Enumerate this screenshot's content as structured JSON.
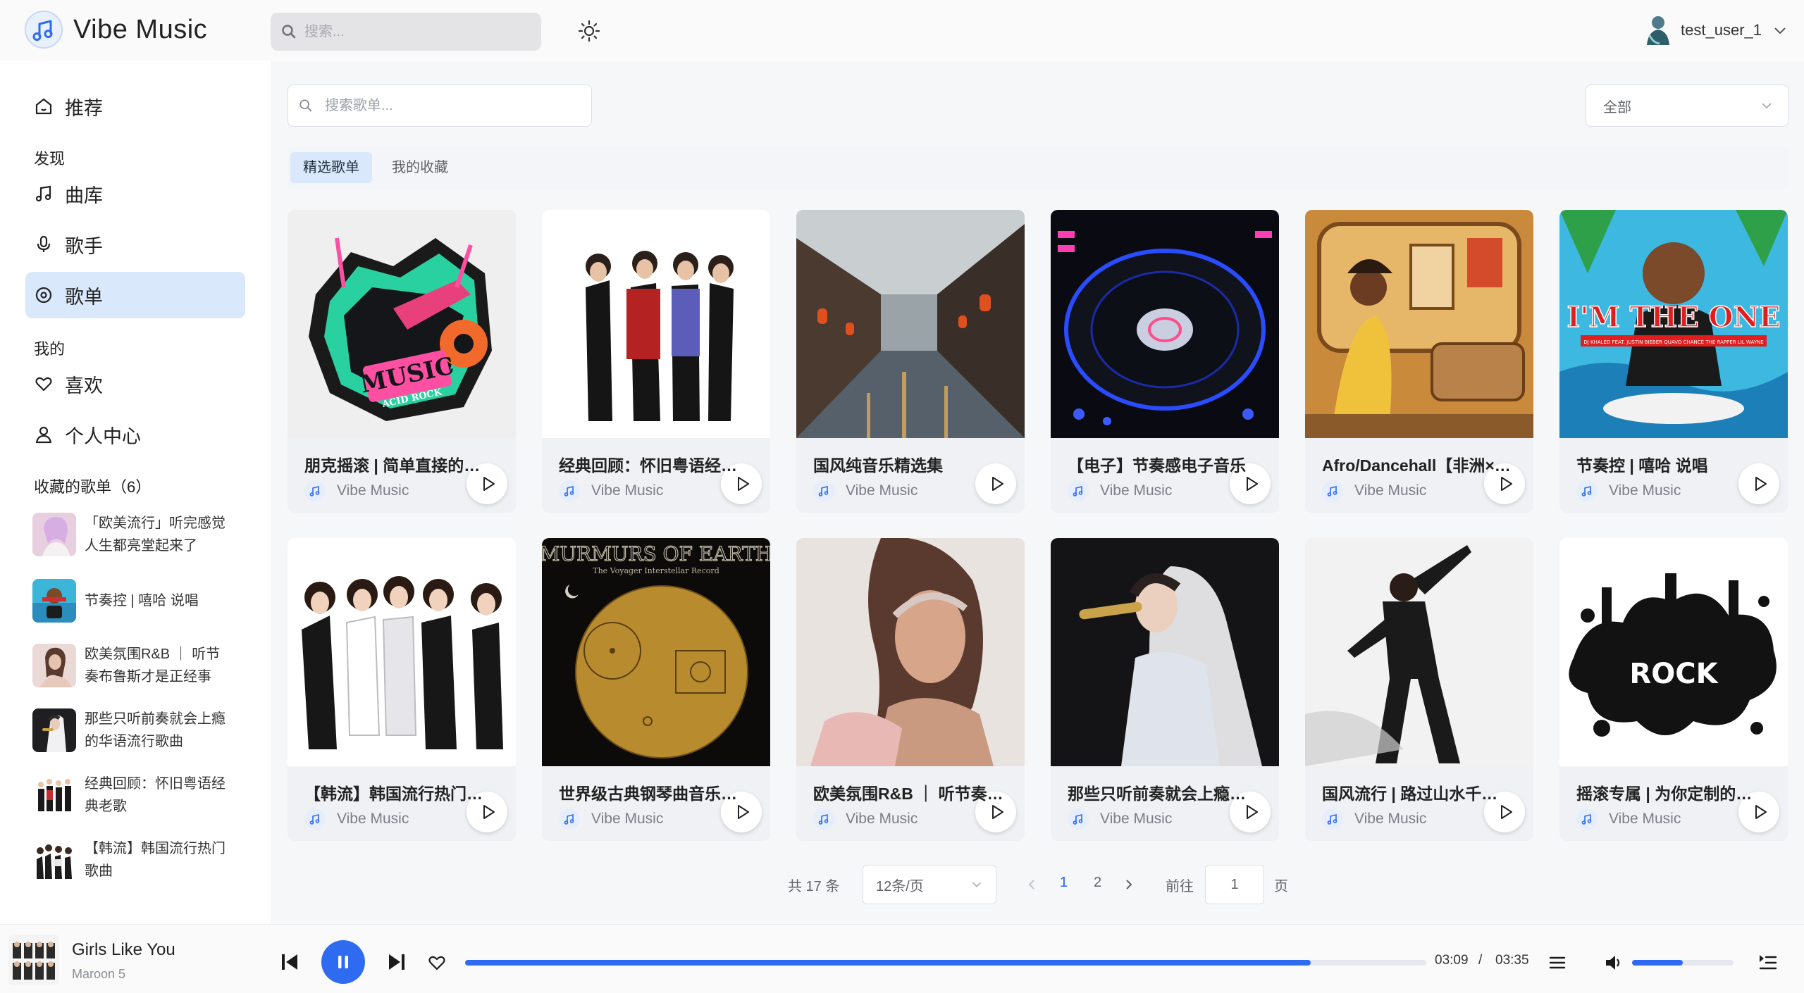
{
  "header": {
    "app_name": "Vibe Music",
    "search_placeholder": "搜索...",
    "username": "test_user_1"
  },
  "sidebar": {
    "nav_recommend": "推荐",
    "section_discover": "发现",
    "nav_library": "曲库",
    "nav_artists": "歌手",
    "nav_playlists": "歌单",
    "section_mine": "我的",
    "nav_likes": "喜欢",
    "nav_profile": "个人中心",
    "collections_title": "收藏的歌单（6）",
    "collections": [
      {
        "line1": "「欧美流行」听完感觉",
        "line2": "人生都亮堂起来了"
      },
      {
        "line1": "节奏控 | 嘻哈 说唱",
        "line2": ""
      },
      {
        "line1": "欧美氛围R&B ｜ 听节",
        "line2": "奏布鲁斯才是正经事"
      },
      {
        "line1": "那些只听前奏就会上瘾",
        "line2": "的华语流行歌曲"
      },
      {
        "line1": "经典回顾：怀旧粤语经",
        "line2": "典老歌"
      },
      {
        "line1": "【韩流】韩国流行热门",
        "line2": "歌曲"
      }
    ]
  },
  "main": {
    "search_placeholder": "搜索歌单...",
    "category_value": "全部",
    "tabs": [
      "精选歌单",
      "我的收藏"
    ],
    "playlists": [
      {
        "title": "朋克摇滚 | 简单直接的…",
        "author": "Vibe Music"
      },
      {
        "title": "经典回顾：怀旧粤语经…",
        "author": "Vibe Music"
      },
      {
        "title": "国风纯音乐精选集",
        "author": "Vibe Music"
      },
      {
        "title": "【电子】节奏感电子音乐",
        "author": "Vibe Music"
      },
      {
        "title": "Afro/Dancehall【非洲×…",
        "author": "Vibe Music"
      },
      {
        "title": "节奏控 | 嘻哈 说唱",
        "author": "Vibe Music"
      },
      {
        "title": "【韩流】韩国流行热门…",
        "author": "Vibe Music"
      },
      {
        "title": "世界级古典钢琴曲音乐…",
        "author": "Vibe Music"
      },
      {
        "title": "欧美氛围R&B ｜ 听节奏…",
        "author": "Vibe Music"
      },
      {
        "title": "那些只听前奏就会上瘾…",
        "author": "Vibe Music"
      },
      {
        "title": "国风流行 | 路过山水千…",
        "author": "Vibe Music"
      },
      {
        "title": "摇滚专属 | 为你定制的…",
        "author": "Vibe Music"
      }
    ],
    "cover_text": {
      "punk_main": "MUSIC",
      "punk_sub": "ACID ROCK",
      "hiphop_main": "I'M THE ONE",
      "hiphop_sub": "DJ KHALED FEAT. JUSTIN BIEBER QUAVO CHANCE THE RAPPER LIL WAYNE",
      "classical_main": "MURMURS OF EARTH",
      "classical_sub": "The Voyager Interstellar Record",
      "rock_main": "ROCK"
    },
    "pagination": {
      "total": "共 17 条",
      "page_size": "12条/页",
      "pages": [
        "1",
        "2"
      ],
      "goto_label": "前往",
      "goto_value": "1",
      "page_suffix": "页"
    }
  },
  "player": {
    "title": "Girls Like You",
    "artist": "Maroon 5",
    "current_time": "03:09",
    "separator": "/",
    "total_time": "03:35",
    "progress": 0.88,
    "volume": 0.5
  },
  "colors": {
    "accent": "#2f6bf0",
    "active_bg": "#d9e8fb",
    "page_number_active": "#2563eb"
  },
  "icons": {
    "logo": "music-note-icon",
    "search": "search-icon",
    "theme": "sun-icon",
    "play": "play-icon",
    "pause": "pause-icon",
    "prev": "skip-previous-icon",
    "next": "skip-next-icon",
    "like": "heart-icon",
    "playlist": "list-icon",
    "volume": "volume-icon",
    "queue": "queue-icon"
  }
}
